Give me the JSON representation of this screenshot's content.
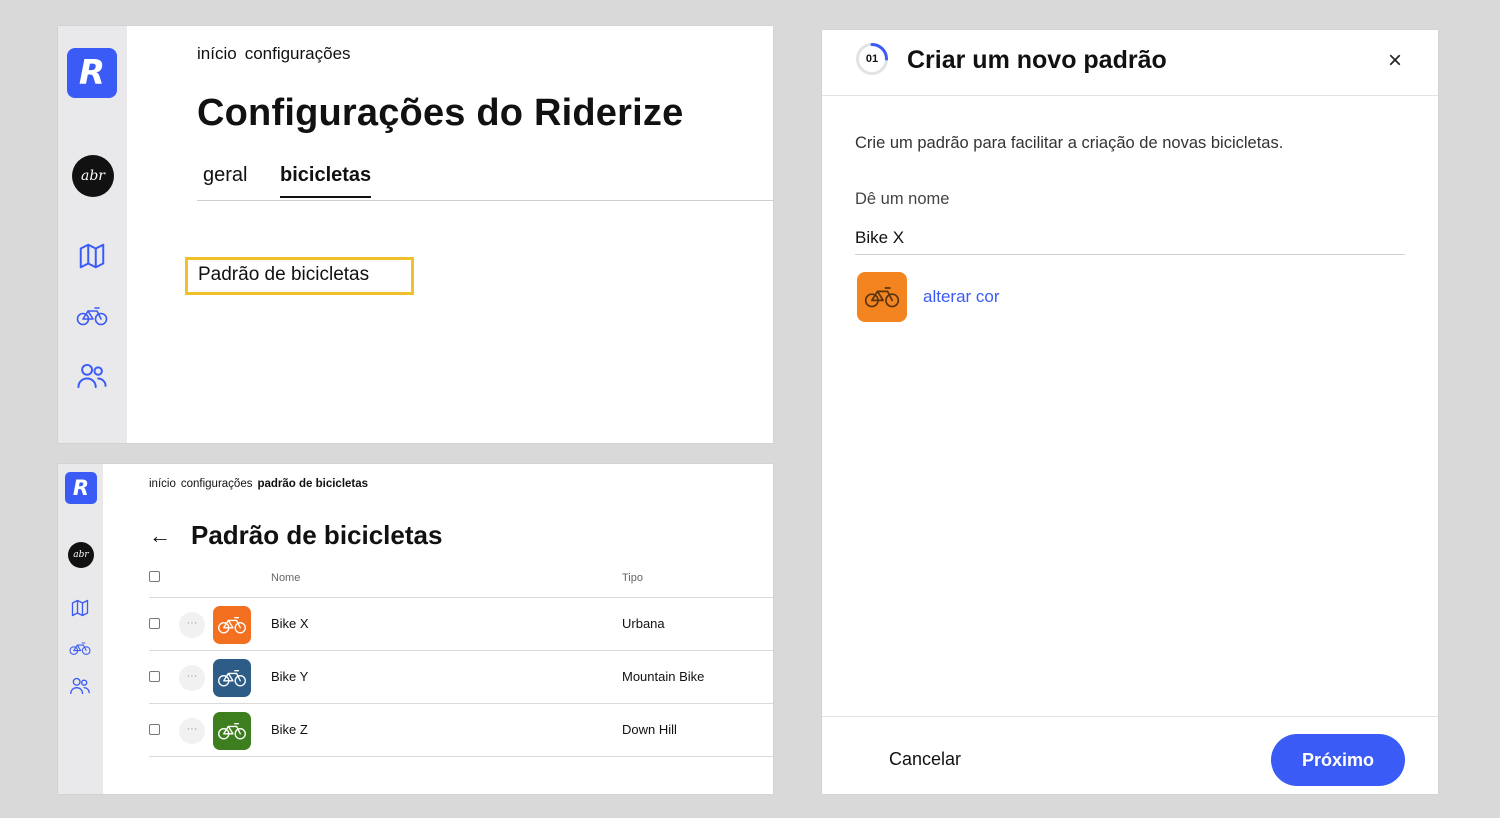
{
  "brand": {
    "logo_letter": "R",
    "avatar_text": "abr",
    "accent": "#3b5bf6",
    "highlight": "#f0c12a"
  },
  "nav_icons": [
    "map-icon",
    "bicycle-icon",
    "users-icon"
  ],
  "settings_page": {
    "breadcrumb": [
      "início",
      "configurações"
    ],
    "title": "Configurações do Riderize",
    "tabs": [
      {
        "label": "geral",
        "active": false
      },
      {
        "label": "bicicletas",
        "active": true
      }
    ],
    "section_link": "Padrão de bicicletas"
  },
  "patterns_page": {
    "breadcrumb": [
      "início",
      "configurações",
      "padrão de bicicletas"
    ],
    "title": "Padrão de bicicletas",
    "columns": {
      "name": "Nome",
      "type": "Tipo"
    },
    "more_label": "···",
    "rows": [
      {
        "name": "Bike X",
        "type": "Urbana",
        "color": "#f2701f"
      },
      {
        "name": "Bike Y",
        "type": "Mountain Bike",
        "color": "#2d5d86"
      },
      {
        "name": "Bike Z",
        "type": "Down Hill",
        "color": "#3d7f1e"
      }
    ]
  },
  "modal": {
    "step": "01",
    "title": "Criar um novo padrão",
    "close_icon": "×",
    "description": "Crie um padrão para facilitar a criação de novas bicicletas.",
    "name_label": "Dê um nome",
    "name_value": "Bike X",
    "color": "#f4841f",
    "change_color_label": "alterar cor",
    "cancel_label": "Cancelar",
    "next_label": "Próximo"
  }
}
